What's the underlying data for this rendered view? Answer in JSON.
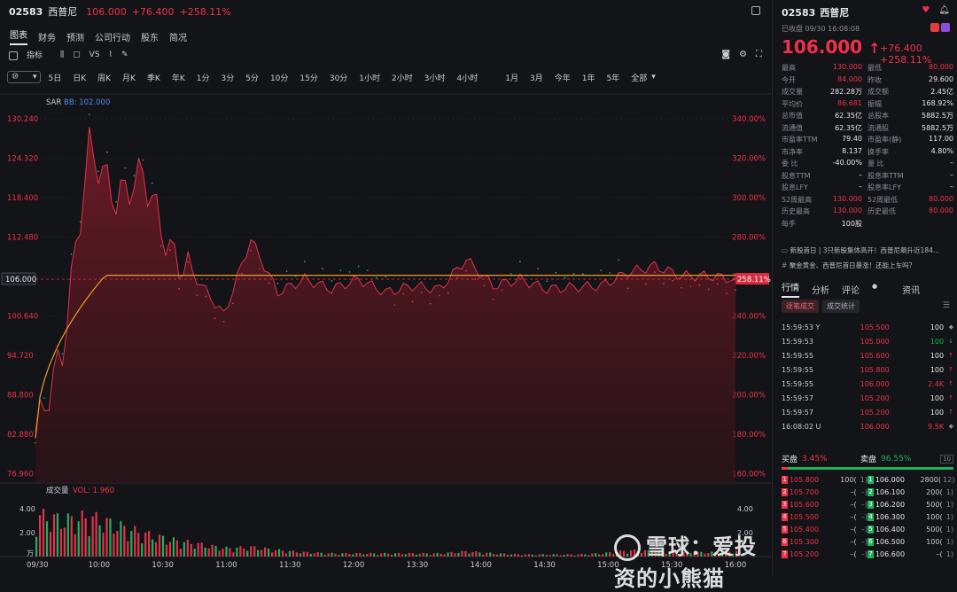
{
  "header": {
    "code": "02583",
    "name": "西普尼",
    "price": "106.000",
    "change": "+76.400",
    "pct": "+258.11%"
  },
  "tabs": [
    "图表",
    "财务",
    "预测",
    "公司行动",
    "股东",
    "简况"
  ],
  "toolbar": {
    "indicator": "指标",
    "vs": "VS"
  },
  "period_select": "⑩",
  "periods": [
    "5日",
    "日K",
    "周K",
    "月K",
    "季K",
    "年K",
    "1分",
    "3分",
    "5分",
    "10分",
    "15分",
    "30分",
    "1小时",
    "2小时",
    "3小时",
    "4小时",
    "1月",
    "3月",
    "今年",
    "1年",
    "5年",
    "全部"
  ],
  "chart": {
    "indicator_label": "SAR",
    "indicator_value": "BB: 102.000",
    "last_price_tag": "106.000",
    "last_pct_tag": "258.11%",
    "y_left": [
      "130.240",
      "124.320",
      "118.400",
      "112.480",
      "106.000",
      "100.640",
      "94.720",
      "88.800",
      "82.880",
      "76.960"
    ],
    "y_right": [
      "340.00%",
      "320.00%",
      "300.00%",
      "280.00%",
      "260.00%",
      "240.00%",
      "220.00%",
      "200.00%",
      "180.00%",
      "160.00%"
    ],
    "vol_label": "成交量",
    "vol_value": "VOL: 1.960",
    "vol_y": [
      "4.00",
      "2.00",
      "万"
    ],
    "vol_y_right": [
      "4.00",
      "2.00"
    ],
    "x_labels": [
      "09/30",
      "10:00",
      "10:30",
      "11:00",
      "11:30",
      "12:00",
      "13:30",
      "14:00",
      "14:30",
      "15:00",
      "15:30",
      "16:00"
    ]
  },
  "chart_data": {
    "type": "line",
    "title": "",
    "x": [
      "09:30",
      "09:35",
      "09:40",
      "09:45",
      "09:50",
      "09:55",
      "10:00",
      "10:10",
      "10:20",
      "10:30",
      "10:45",
      "11:00",
      "11:15",
      "11:30",
      "11:45",
      "12:00",
      "13:30",
      "13:45",
      "14:00",
      "14:15",
      "14:30",
      "14:45",
      "15:00",
      "15:15",
      "15:30",
      "15:45",
      "16:00"
    ],
    "series": [
      {
        "values": [
          82.9,
          95.0,
          126.0,
          118.0,
          122.0,
          110.0,
          106.0,
          100.6,
          112.0,
          104.0,
          106.0,
          104.5,
          106.0,
          104.0,
          105.0,
          104.5,
          109.0,
          105.0,
          106.0,
          104.5,
          104.8,
          105.0,
          107.0,
          108.0,
          106.5,
          106.5,
          106.0
        ]
      }
    ],
    "ylim": [
      76.96,
      130.24
    ],
    "volume": {
      "values": [
        4.0,
        3.5,
        3.8,
        3.0,
        2.2,
        1.6,
        1.2,
        0.8,
        0.9,
        0.6,
        0.4,
        0.3,
        0.3,
        0.3,
        0.3,
        0.3,
        0.5,
        0.3,
        0.2,
        0.2,
        0.2,
        0.3,
        0.6,
        0.5,
        0.4,
        0.4,
        0.5
      ],
      "ylim": [
        0,
        4.5
      ]
    }
  },
  "right": {
    "title_code": "02583",
    "title_name": "西普尼",
    "status": "已收盘 09/30 16:08:08",
    "price": "106.000",
    "arrow": "↑",
    "change": "+76.400",
    "pct": "+258.11%",
    "stats": [
      [
        "最高",
        "130.000",
        "最低",
        "80.000"
      ],
      [
        "今开",
        "84.000",
        "昨收",
        "29.600"
      ],
      [
        "成交量",
        "282.28万",
        "成交额",
        "2.45亿"
      ],
      [
        "平均价",
        "86.681",
        "振幅",
        "168.92%"
      ],
      [
        "总市值",
        "62.35亿",
        "总股本",
        "5882.5万"
      ],
      [
        "流通值",
        "62.35亿",
        "流通股",
        "5882.5万"
      ],
      [
        "市盈率TTM",
        "79.40",
        "市盈率(静)",
        "117.00"
      ],
      [
        "市净率",
        "8.137",
        "换手率",
        "4.80%"
      ],
      [
        "委 比",
        "-40.00%",
        "量 比",
        "–"
      ],
      [
        "股息TTM",
        "–",
        "股息率TTM",
        "–"
      ],
      [
        "股息LFY",
        "–",
        "股息率LFY",
        "–"
      ],
      [
        "52周最高",
        "130.000",
        "52周最低",
        "80.000"
      ],
      [
        "历史最高",
        "130.000",
        "历史最低",
        "80.000"
      ],
      [
        "每手",
        "100股",
        "",
        ""
      ]
    ],
    "news": [
      "新股首日 | 3只新股集体高开！西普尼飙升近184...",
      "聚金黄金、西普尼首日暴涨！还能上车吗？"
    ],
    "tabs": [
      "行情",
      "分析",
      "评论",
      "资讯"
    ],
    "subtabs": [
      "逐笔成交",
      "成交统计"
    ],
    "trades": [
      [
        "15:59:53 Y",
        "105.500",
        "100",
        "◆",
        "w"
      ],
      [
        "15:59:53",
        "105.000",
        "100",
        "↓",
        "g"
      ],
      [
        "15:59:55",
        "105.600",
        "100",
        "↑",
        "r"
      ],
      [
        "15:59:55",
        "105.800",
        "100",
        "↑",
        "r"
      ],
      [
        "15:59:55",
        "106.000",
        "2.4K",
        "↑",
        "r"
      ],
      [
        "15:59:57",
        "105.200",
        "100",
        "↑",
        "r"
      ],
      [
        "15:59:57",
        "105.200",
        "100",
        "↑",
        "r"
      ],
      [
        "16:08:02 U",
        "106.000",
        "9.5K",
        "◆",
        "w"
      ]
    ],
    "orderbook": {
      "buy_label": "买盘",
      "buy_pct": "3.45%",
      "sell_label": "卖盘",
      "sell_pct": "96.55%",
      "depth": "10",
      "bids": [
        [
          "1",
          "105.800",
          "100(",
          "1)"
        ],
        [
          "2",
          "105.700",
          "–(",
          "–)"
        ],
        [
          "3",
          "105.600",
          "–(",
          "–)"
        ],
        [
          "4",
          "105.500",
          "–(",
          "–)"
        ],
        [
          "5",
          "105.400",
          "–(",
          "–)"
        ],
        [
          "6",
          "105.300",
          "–(",
          "–)"
        ],
        [
          "7",
          "105.200",
          "–(",
          "–)"
        ]
      ],
      "asks": [
        [
          "1",
          "106.000",
          "2800(",
          "12)"
        ],
        [
          "2",
          "106.100",
          "200(",
          "1)"
        ],
        [
          "3",
          "106.200",
          "500(",
          "1)"
        ],
        [
          "4",
          "106.300",
          "100(",
          "1)"
        ],
        [
          "5",
          "106.400",
          "500(",
          "1)"
        ],
        [
          "6",
          "106.500",
          "100(",
          "1)"
        ],
        [
          "7",
          "106.600",
          "–(",
          "1)"
        ]
      ]
    }
  },
  "watermark": "雪球：爱投资的小熊猫"
}
